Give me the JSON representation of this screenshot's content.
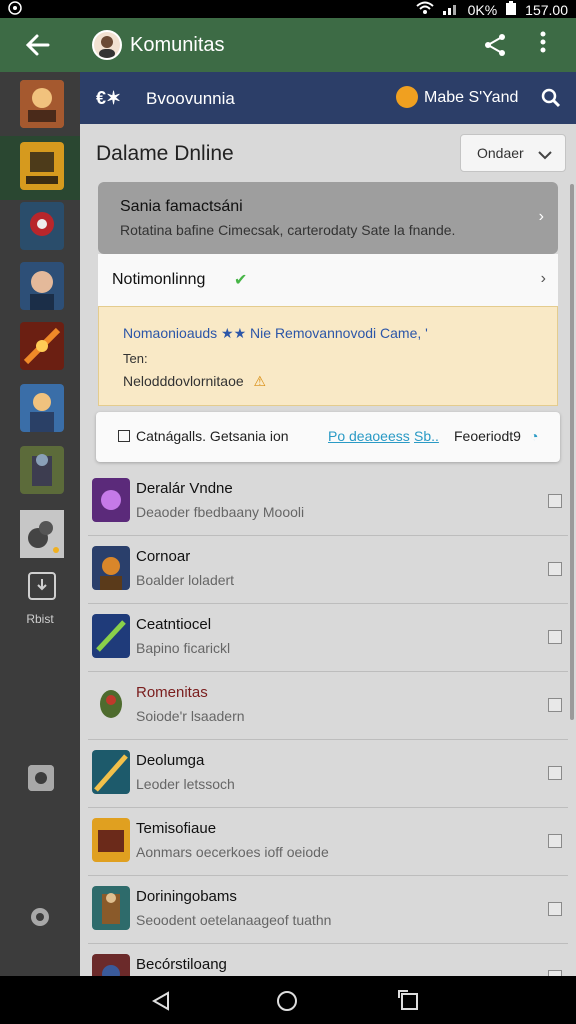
{
  "status_bar": {
    "left_icon": "lens-icon",
    "battery": "0K%",
    "time": "157.00"
  },
  "app_bar": {
    "title": "Komunitas",
    "avatar": "profile-avatar"
  },
  "sidebar": {
    "board_label": "Rbist"
  },
  "second_bar": {
    "left_icon_text": "€✶",
    "left_title": "Bvoovunnia",
    "right_title": "Mabe S'Yand"
  },
  "page": {
    "heading": "Dalame Dnline",
    "order_label": "Ondaer"
  },
  "cards": {
    "card1_title": "Sania famactsáni",
    "card1_sub": "Rotatina bafine Cimecsak, carterodaty Sate la fnande.",
    "card2_title": "Notimonlinng",
    "card3_line1": "Nomaonioauds ★★ Nie Removannovodi Came, '",
    "card3_line2": "Ten:",
    "card3_line3": "Nelodddovlornitaoe",
    "card4_text": "Catnágalls. Getsania ion",
    "card4_link1": "Po deaoeess",
    "card4_link2": "Sb..",
    "card4_tail": "Feoeriodt9"
  },
  "games": [
    {
      "name": "Deralár Vndne",
      "sub": "Deaoder fbedbaany Moooli",
      "name_color": "#111111"
    },
    {
      "name": "Cornoar",
      "sub": "Boalder loladert",
      "name_color": "#111111"
    },
    {
      "name": "Ceatntiocel",
      "sub": "Bapino ficarickl",
      "name_color": "#111111"
    },
    {
      "name": "Romenitas",
      "sub": "Soiode'r lsaadern",
      "name_color": "#7a1d1d"
    },
    {
      "name": "Deolumga",
      "sub": "Leoder letssoch",
      "name_color": "#111111"
    },
    {
      "name": "Temisofiaue",
      "sub": "Aonmars oecerkoes ioff oeiode",
      "name_color": "#111111"
    },
    {
      "name": "Doriningobams",
      "sub": "Seoodent oetelanaageof tuathn",
      "name_color": "#111111"
    },
    {
      "name": "Becórstiloang",
      "sub": "",
      "name_color": "#111111"
    }
  ],
  "colors": {
    "app_green": "#3d6b45",
    "second_bar_blue": "#2c3e68",
    "sidebar_gray": "#3c3c3c",
    "content_gray": "#d9d9d9",
    "warning_card": "#f9e9c6"
  }
}
